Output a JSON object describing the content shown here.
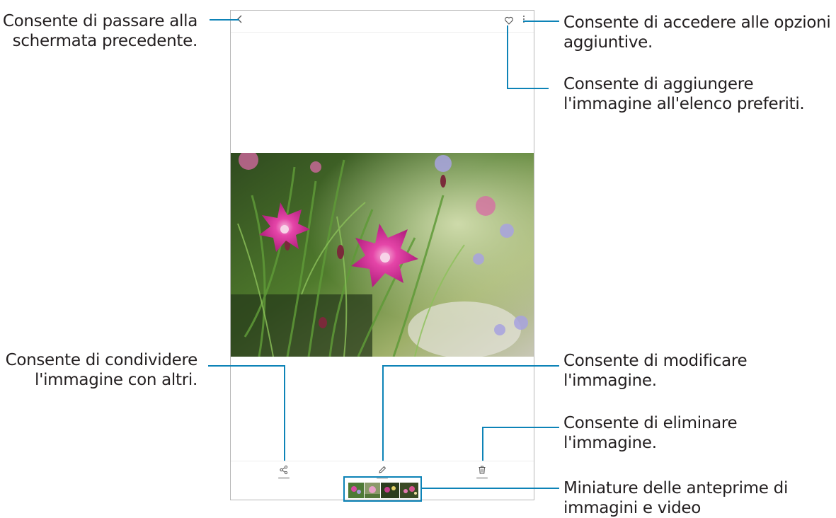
{
  "annotations": {
    "back": [
      "Consente di passare alla",
      "schermata precedente."
    ],
    "more_options": [
      "Consente di accedere alle opzioni",
      "aggiuntive."
    ],
    "favorite": [
      "Consente di aggiungere",
      "l'immagine all'elenco preferiti."
    ],
    "share": [
      "Consente di condividere",
      "l'immagine con altri."
    ],
    "edit": [
      "Consente di modificare",
      "l'immagine."
    ],
    "delete": [
      "Consente di eliminare",
      "l'immagine."
    ],
    "thumbnails": [
      "Miniature delle anteprime di",
      "immagini e video"
    ]
  },
  "colors": {
    "callout_line": "#0d83b7",
    "text": "#231f20",
    "screen_border": "#b7b7b7"
  },
  "icons": {
    "back": "chevron-left-icon",
    "favorite": "heart-outline-icon",
    "more": "vertical-dots-icon",
    "share": "share-icon",
    "edit": "pencil-icon",
    "delete": "trash-icon"
  },
  "thumbnail_count": 4
}
